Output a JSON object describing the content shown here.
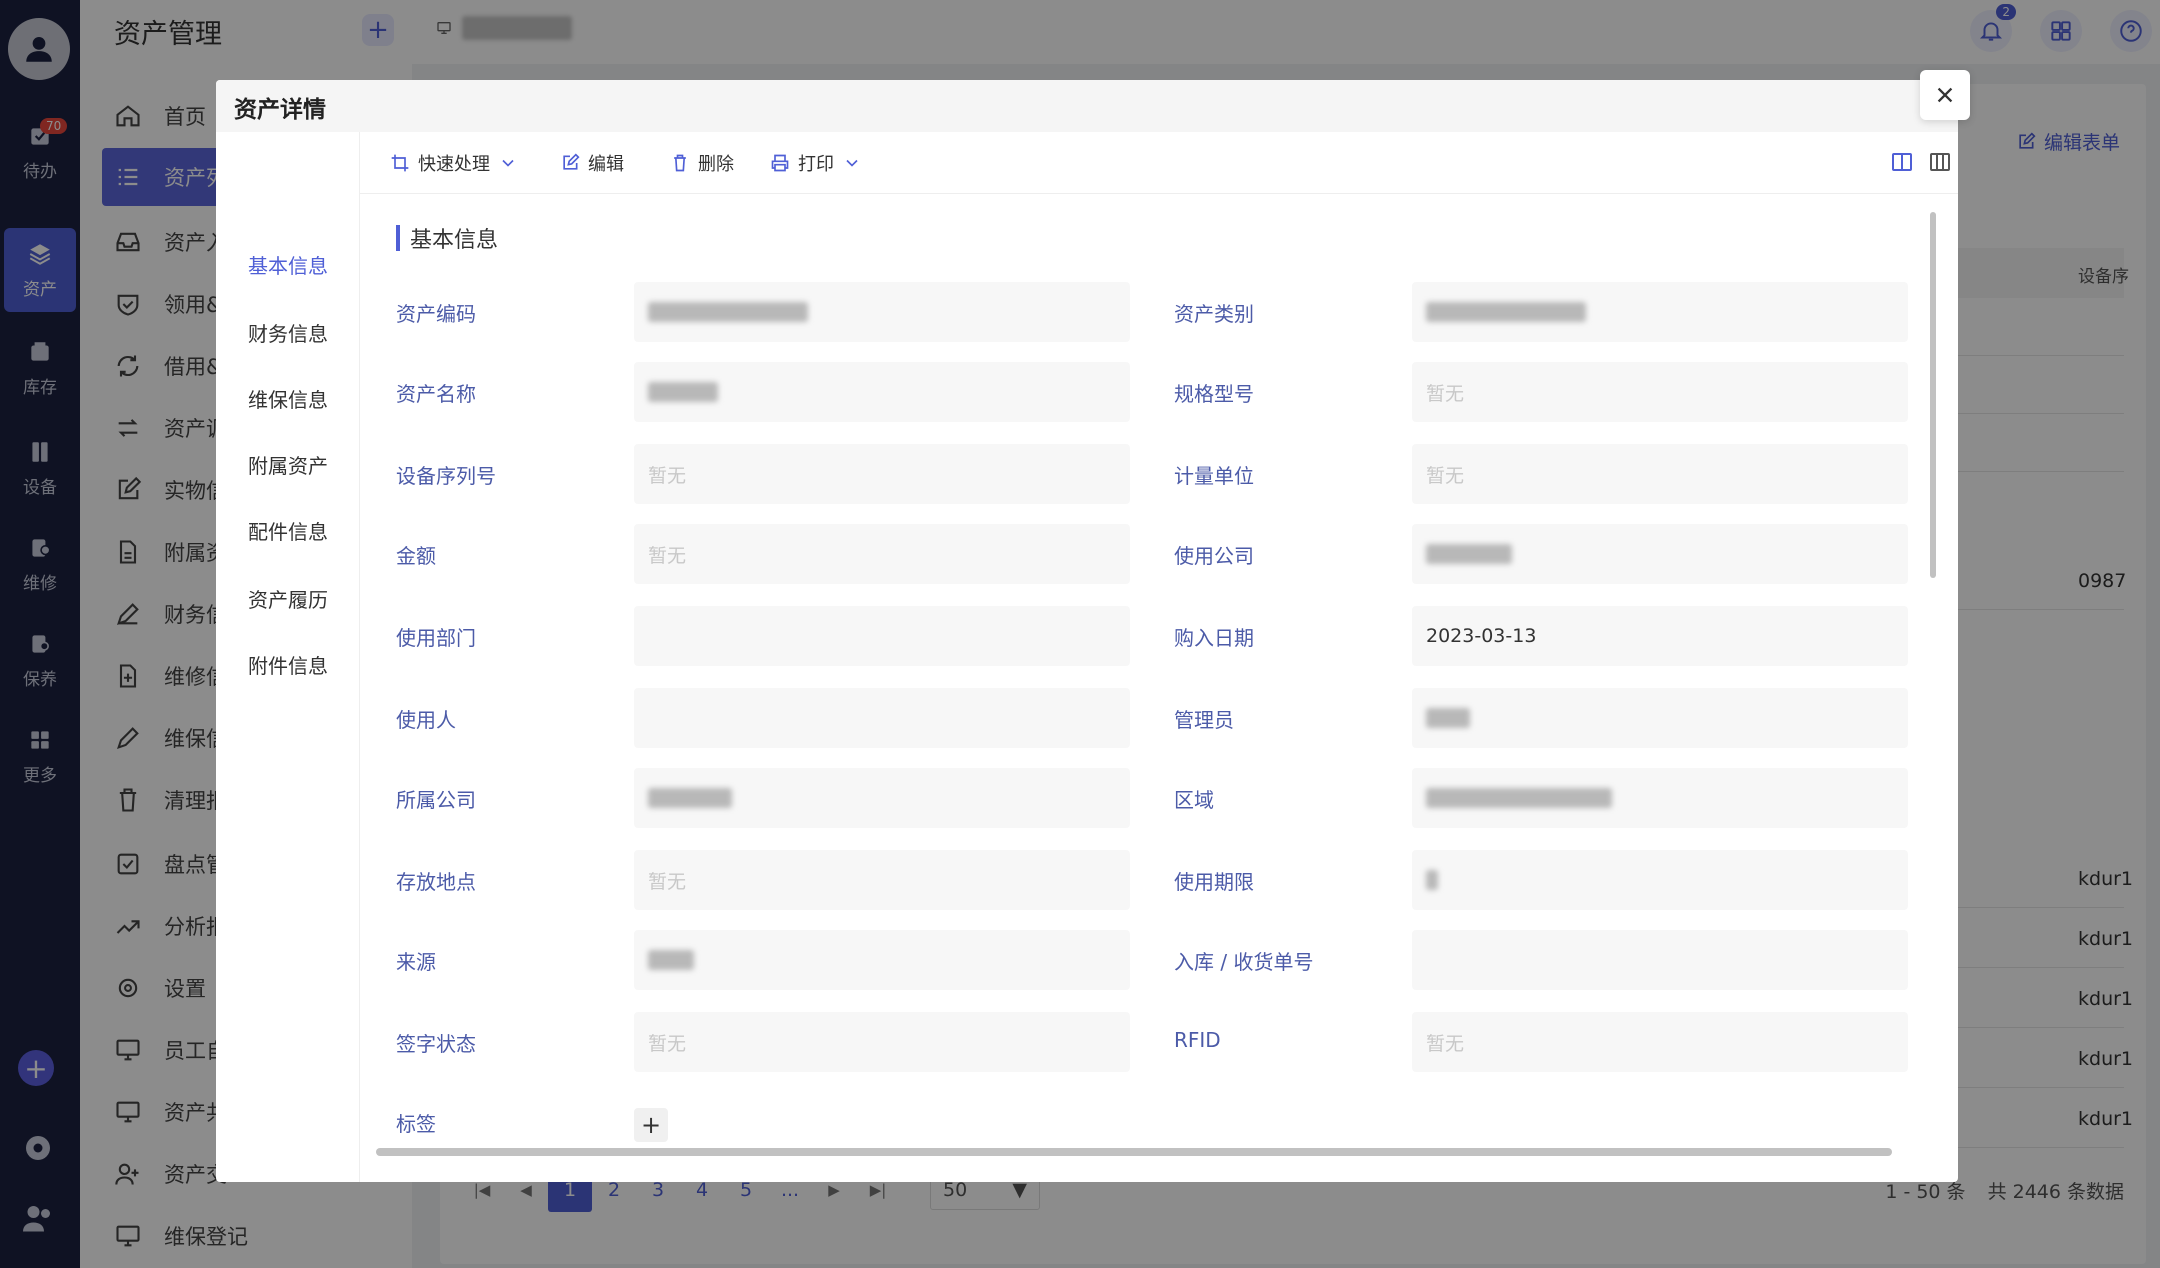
{
  "left_rail": {
    "items": [
      {
        "label": "待办",
        "icon": "todo-icon",
        "badge": "70"
      },
      {
        "label": "资产",
        "icon": "layers-icon"
      },
      {
        "label": "库存",
        "icon": "inventory-icon"
      },
      {
        "label": "设备",
        "icon": "device-icon"
      },
      {
        "label": "维修",
        "icon": "repair-icon"
      },
      {
        "label": "保养",
        "icon": "maintenance-icon"
      },
      {
        "label": "更多",
        "icon": "more-icon"
      }
    ]
  },
  "sidebar": {
    "title": "资产管理",
    "add_label": "+",
    "items": [
      {
        "label": "首页"
      },
      {
        "label": "资产列"
      },
      {
        "label": "资产入"
      },
      {
        "label": "领用&"
      },
      {
        "label": "借用&"
      },
      {
        "label": "资产调"
      },
      {
        "label": "实物信"
      },
      {
        "label": "附属资"
      },
      {
        "label": "财务信"
      },
      {
        "label": "维修信"
      },
      {
        "label": "维保信"
      },
      {
        "label": "清理报"
      },
      {
        "label": "盘点管"
      },
      {
        "label": "分析报"
      },
      {
        "label": "设置"
      },
      {
        "label": "员工自"
      },
      {
        "label": "资产共"
      },
      {
        "label": "资产交"
      },
      {
        "label": "维保登记"
      }
    ]
  },
  "topbar": {
    "notification_count": "2"
  },
  "background": {
    "edit_form_label": "编辑表单",
    "column_header": "设备序",
    "cells": [
      "0987",
      "kdur1",
      "kdur1",
      "kdur1",
      "kdur1",
      "kdur1"
    ],
    "pagination": {
      "pages": [
        "1",
        "2",
        "3",
        "4",
        "5",
        "..."
      ],
      "page_size": "50",
      "range": "1 - 50 条",
      "total": "共 2446 条数据"
    }
  },
  "modal": {
    "title": "资产详情",
    "tabs": [
      "基本信息",
      "财务信息",
      "维保信息",
      "附属资产",
      "配件信息",
      "资产履历",
      "附件信息"
    ],
    "toolbar": {
      "quick": "快速处理",
      "edit": "编辑",
      "delete": "删除",
      "print": "打印"
    },
    "section_title": "基本信息",
    "placeholder": "暂无",
    "fields": [
      {
        "label": "资产编码",
        "value": ""
      },
      {
        "label": "资产类别",
        "value": ""
      },
      {
        "label": "资产名称",
        "value": ""
      },
      {
        "label": "规格型号",
        "value": "暂无"
      },
      {
        "label": "设备序列号",
        "value": "暂无"
      },
      {
        "label": "计量单位",
        "value": "暂无"
      },
      {
        "label": "金额",
        "value": "暂无"
      },
      {
        "label": "使用公司",
        "value": ""
      },
      {
        "label": "使用部门",
        "value": ""
      },
      {
        "label": "购入日期",
        "value": "2023-03-13"
      },
      {
        "label": "使用人",
        "value": ""
      },
      {
        "label": "管理员",
        "value": ""
      },
      {
        "label": "所属公司",
        "value": ""
      },
      {
        "label": "区域",
        "value": ""
      },
      {
        "label": "存放地点",
        "value": "暂无"
      },
      {
        "label": "使用期限",
        "value": ""
      },
      {
        "label": "来源",
        "value": ""
      },
      {
        "label": "入库 / 收货单号",
        "value": ""
      },
      {
        "label": "签字状态",
        "value": "暂无"
      },
      {
        "label": "RFID",
        "value": "暂无"
      }
    ],
    "tag_label": "标签",
    "tag_add": "+"
  }
}
